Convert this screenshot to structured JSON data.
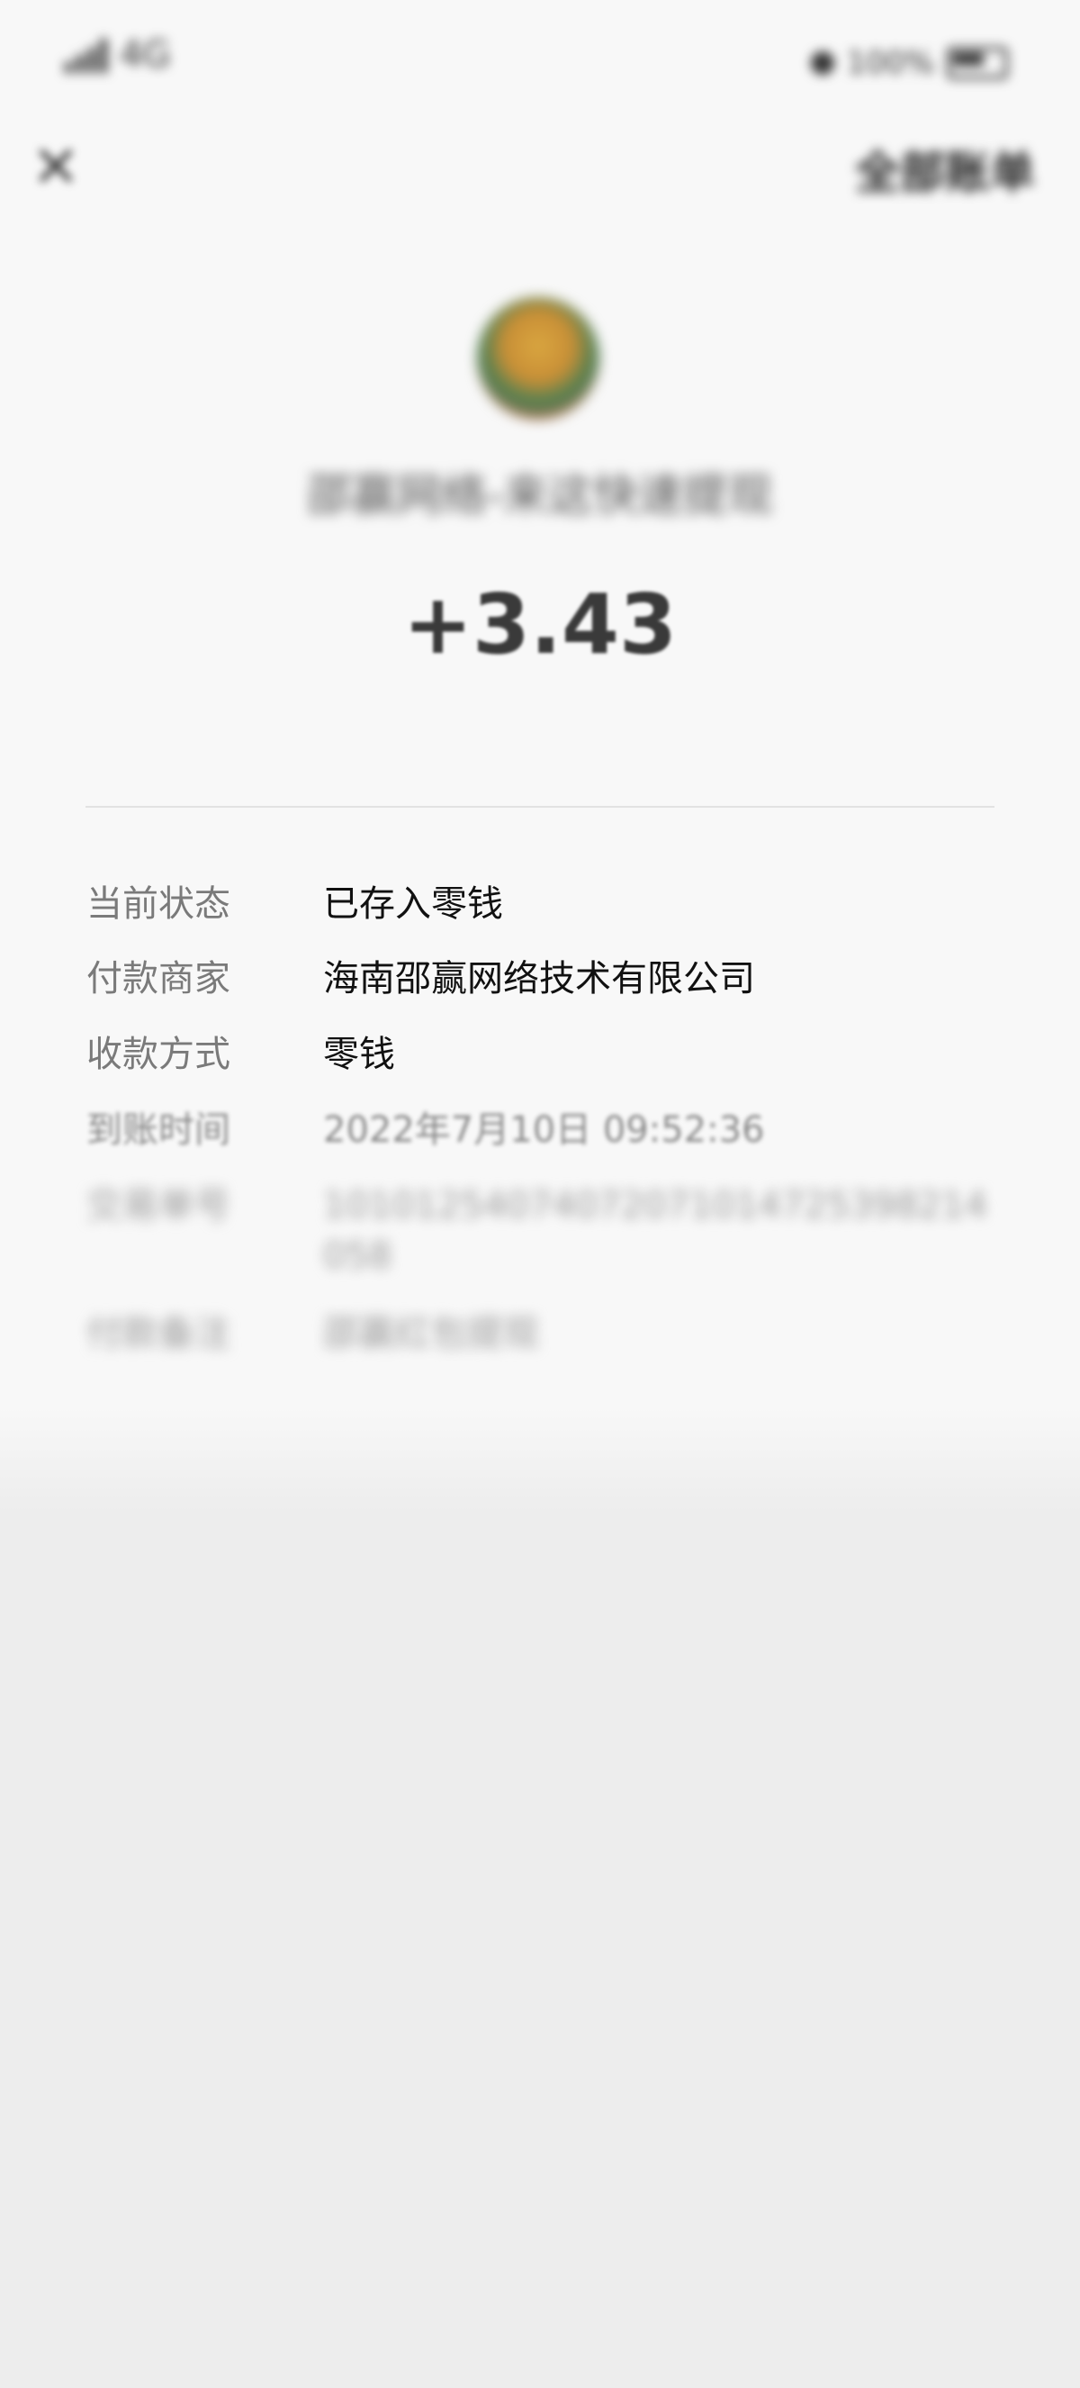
{
  "status_bar": {
    "signal": "4G",
    "right_text": "100%"
  },
  "nav": {
    "close_icon": "close-icon",
    "all_bills": "全部账单"
  },
  "merchant": {
    "avatar_icon": "merchant-avatar",
    "name": "邵赢网络-来这快速提现"
  },
  "amount": "+3.43",
  "details": [
    {
      "label": "当前状态",
      "value": "已存入零钱"
    },
    {
      "label": "付款商家",
      "value": "海南邵赢网络技术有限公司"
    },
    {
      "label": "收款方式",
      "value": "零钱"
    },
    {
      "label": "到账时间",
      "value": "2022年7月10日 09:52:36"
    },
    {
      "label": "交易单号",
      "value": "10101254074072071014725398214058"
    },
    {
      "label": "付款备注",
      "value": "邵赢红包提现"
    }
  ]
}
